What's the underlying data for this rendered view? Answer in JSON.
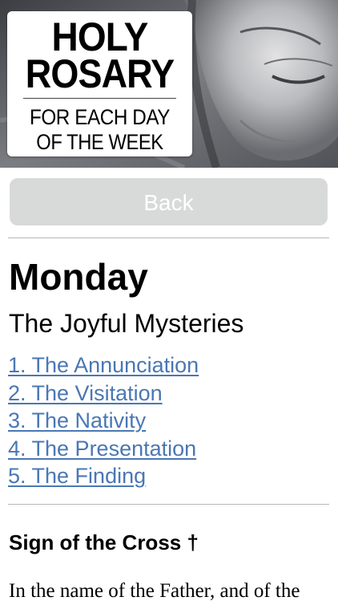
{
  "header": {
    "title_line1": "HOLY",
    "title_line2": "ROSARY",
    "subtitle_line1": "FOR EACH DAY",
    "subtitle_line2": "OF THE WEEK"
  },
  "back_button": {
    "label": "Back"
  },
  "day": {
    "title": "Monday",
    "mysteries_title": "The Joyful Mysteries",
    "mysteries": [
      "1. The Annunciation",
      "2. The Visitation",
      "3. The Nativity",
      "4. The Presentation",
      "5. The Finding"
    ]
  },
  "prayer": {
    "heading": "Sign of the Cross †",
    "text": "In the name of the Father, and of the"
  },
  "colors": {
    "link": "#4a77b4",
    "button_bg": "#d8dad9",
    "divider": "#b8b8b8"
  },
  "icons": {
    "hero_image": "madonna-statue-face"
  }
}
